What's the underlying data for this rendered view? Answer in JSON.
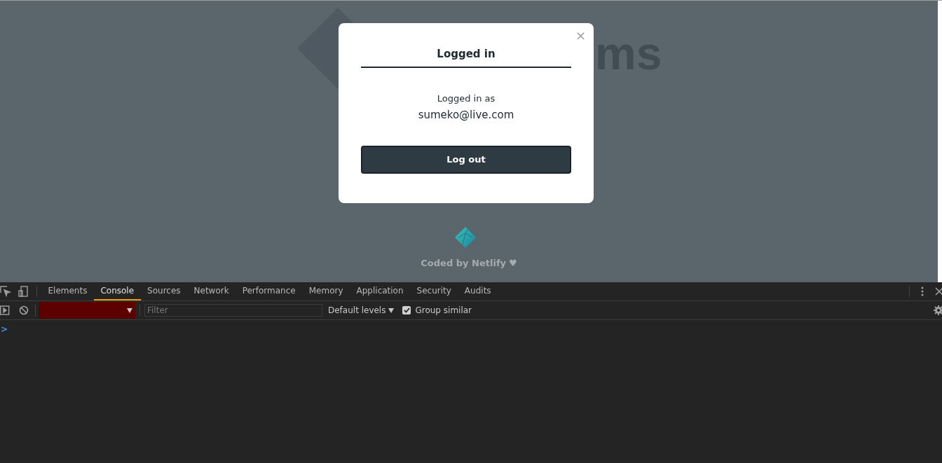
{
  "background": {
    "logo_text": "ms"
  },
  "modal": {
    "close": "×",
    "title": "Logged in",
    "message": "Logged in as",
    "email": "sumeko@live.com",
    "button": "Log out"
  },
  "footer": {
    "text": "Coded by Netlify",
    "heart": "♥"
  },
  "devtools": {
    "tabs": [
      {
        "label": "Elements",
        "selected": false
      },
      {
        "label": "Console",
        "selected": true
      },
      {
        "label": "Sources",
        "selected": false
      },
      {
        "label": "Network",
        "selected": false
      },
      {
        "label": "Performance",
        "selected": false
      },
      {
        "label": "Memory",
        "selected": false
      },
      {
        "label": "Application",
        "selected": false
      },
      {
        "label": "Security",
        "selected": false
      },
      {
        "label": "Audits",
        "selected": false
      }
    ],
    "console": {
      "filter": {
        "placeholder": "Filter"
      },
      "levels": "Default levels",
      "group_similar": {
        "label": "Group similar",
        "checked": true
      },
      "prompt": ">"
    }
  }
}
